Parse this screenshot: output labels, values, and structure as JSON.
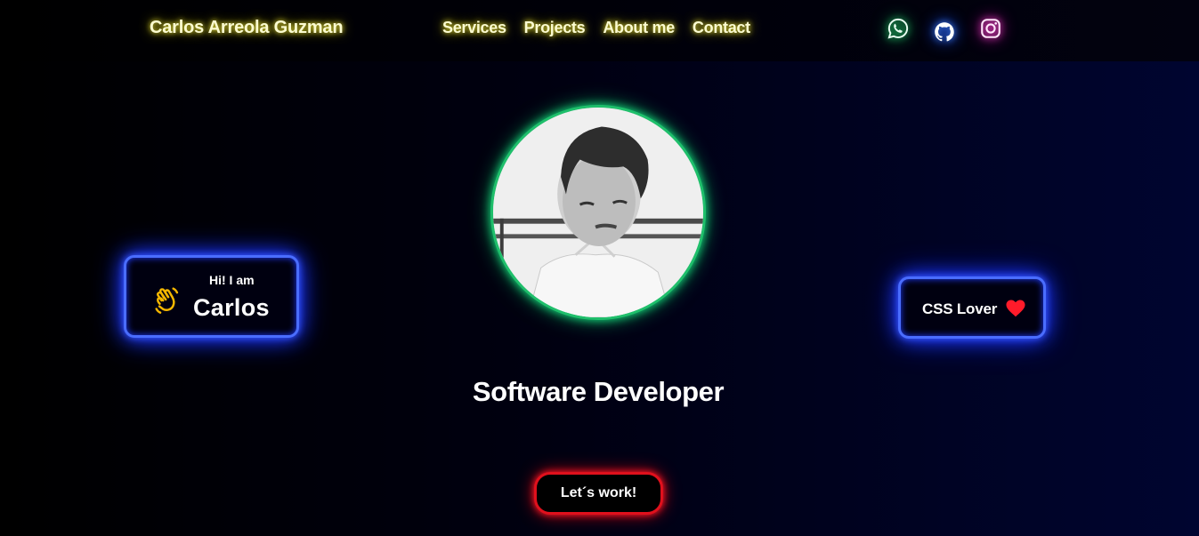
{
  "header": {
    "brand": "Carlos Arreola Guzman",
    "nav": [
      "Services",
      "Projects",
      "About me",
      "Contact"
    ],
    "social": [
      {
        "icon": "whatsapp-icon",
        "color": "#3ddc84"
      },
      {
        "icon": "github-icon",
        "color": "#ffffff"
      },
      {
        "icon": "instagram-icon",
        "color": "#ff4fd8"
      }
    ]
  },
  "hero": {
    "greeting": "Hi! I am",
    "name": "Carlos",
    "greeting_icon": "waving-hand-icon",
    "side_badge": "CSS Lover",
    "side_badge_icon": "heart-icon",
    "role": "Software Developer",
    "cta": "Let´s work!"
  },
  "colors": {
    "brand_glow": "#e8e03a",
    "card_glow": "#1f3aff",
    "avatar_ring": "#1fbf6b",
    "cta_ring": "#e0101c",
    "heart": "#ff1b2a",
    "wave": "#f5b700"
  }
}
